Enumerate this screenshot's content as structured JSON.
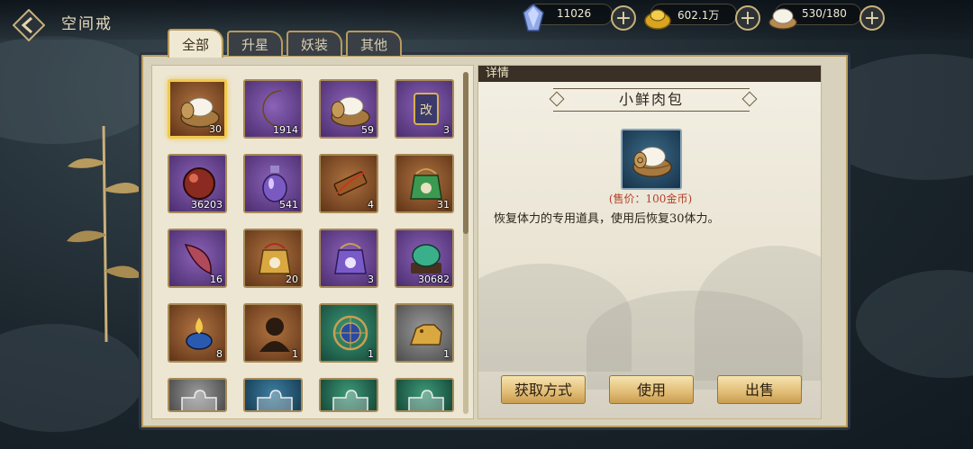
{
  "header": {
    "title": "空间戒",
    "resources": [
      {
        "icon": "crystal-icon",
        "value": "11026"
      },
      {
        "icon": "gold-ingot-icon",
        "value": "602.1万"
      },
      {
        "icon": "steamed-bun-icon",
        "value": "530/180"
      }
    ]
  },
  "tabs": [
    {
      "label": "全部",
      "active": true
    },
    {
      "label": "升星",
      "active": false
    },
    {
      "label": "妖装",
      "active": false
    },
    {
      "label": "其他",
      "active": false
    }
  ],
  "inventory": [
    {
      "icon": "steamed-bun-basket-icon",
      "count": "30",
      "rarity": "orange",
      "selected": true
    },
    {
      "icon": "crescent-moon-icon",
      "count": "1914",
      "rarity": "purple"
    },
    {
      "icon": "steamed-bun-basket-icon",
      "count": "59",
      "rarity": "purple"
    },
    {
      "icon": "scroll-token-icon",
      "count": "3",
      "rarity": "purple"
    },
    {
      "icon": "red-orb-icon",
      "count": "36203",
      "rarity": "purple"
    },
    {
      "icon": "potion-bottle-icon",
      "count": "541",
      "rarity": "purple"
    },
    {
      "icon": "wooden-charm-icon",
      "count": "4",
      "rarity": "orange"
    },
    {
      "icon": "green-pouch-icon",
      "count": "31",
      "rarity": "orange"
    },
    {
      "icon": "red-fang-icon",
      "count": "16",
      "rarity": "purple"
    },
    {
      "icon": "gold-pouch-icon",
      "count": "20",
      "rarity": "orange"
    },
    {
      "icon": "purple-pouch-icon",
      "count": "3",
      "rarity": "purple"
    },
    {
      "icon": "jade-beast-icon",
      "count": "30682",
      "rarity": "purple"
    },
    {
      "icon": "blue-lamp-icon",
      "count": "8",
      "rarity": "orange"
    },
    {
      "icon": "silhouette-icon",
      "count": "1",
      "rarity": "orange"
    },
    {
      "icon": "astrolabe-icon",
      "count": "1",
      "rarity": "green"
    },
    {
      "icon": "golden-tiger-icon",
      "count": "1",
      "rarity": "grey"
    },
    {
      "icon": "puzzle-piece-icon",
      "count": "",
      "rarity": "grey"
    },
    {
      "icon": "puzzle-piece-icon",
      "count": "",
      "rarity": "blue"
    },
    {
      "icon": "puzzle-piece-icon",
      "count": "",
      "rarity": "green"
    },
    {
      "icon": "puzzle-piece-icon",
      "count": "",
      "rarity": "green"
    }
  ],
  "scroll_position": 0.0,
  "detail": {
    "header": "详情",
    "item_name": "小鲜肉包",
    "item_icon": "steamed-bun-basket-icon",
    "price": "(售价：100金币)",
    "description": "恢复体力的专用道具，使用后恢复30体力。"
  },
  "actions": {
    "obtain": "获取方式",
    "use": "使用",
    "sell": "出售"
  },
  "colors": {
    "accent_gold": "#e3c07a",
    "price_red": "#b2402a",
    "selected_border": "#f2c94c"
  }
}
